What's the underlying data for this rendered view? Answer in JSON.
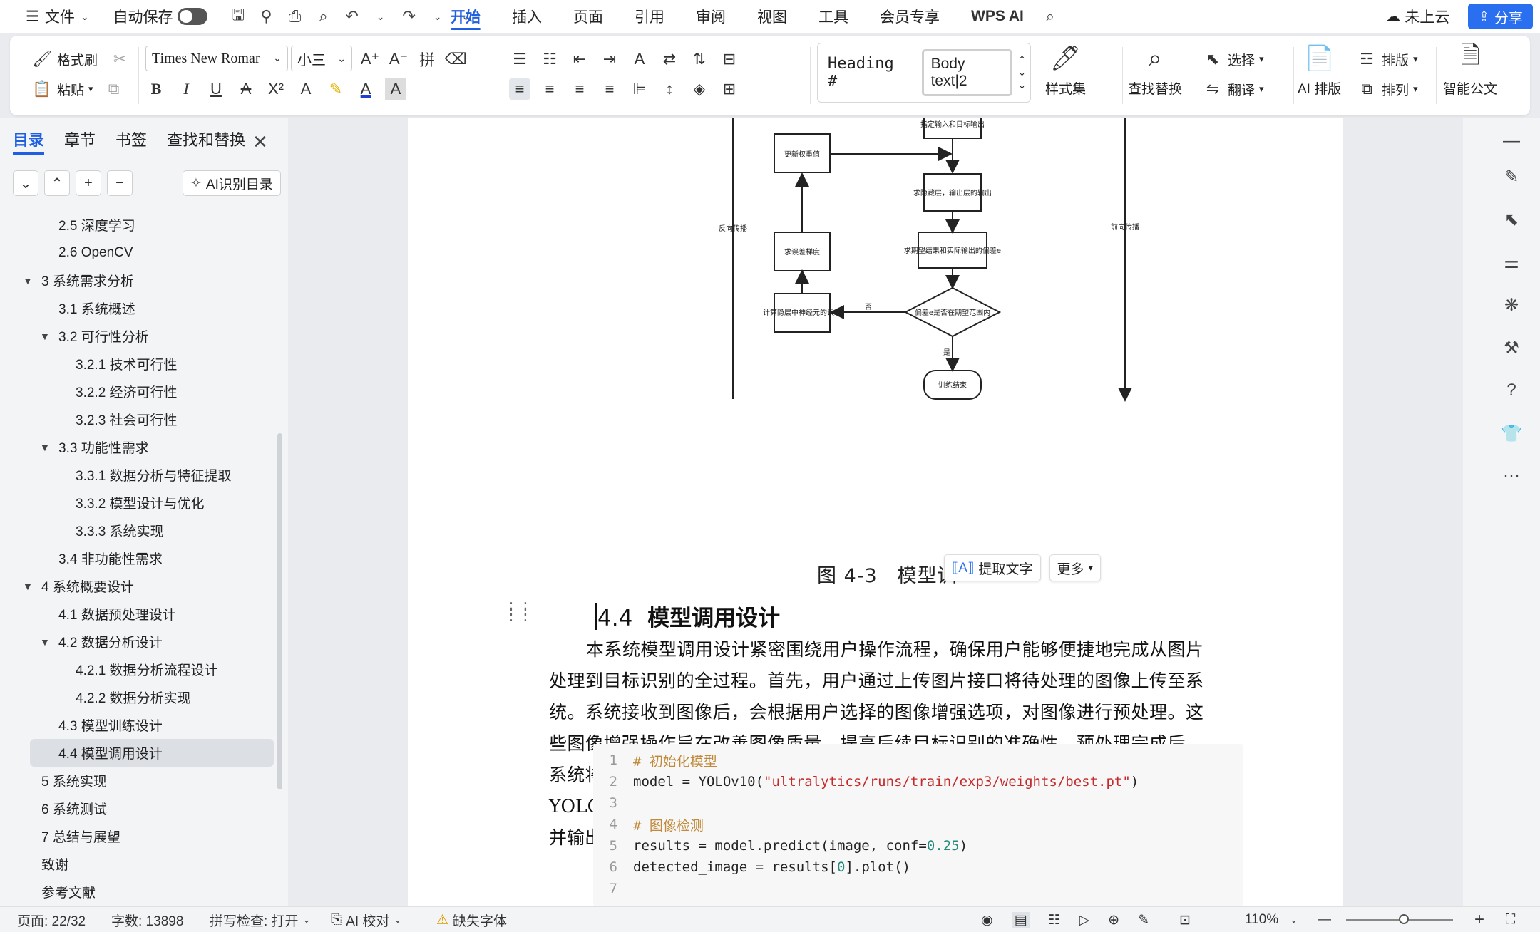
{
  "menubar": {
    "file": "文件",
    "autosave": "自动保存",
    "tabs": [
      "开始",
      "插入",
      "页面",
      "引用",
      "审阅",
      "视图",
      "工具",
      "会员专享",
      "WPS AI"
    ],
    "active_tab": "开始",
    "cloud": "未上云",
    "share": "分享"
  },
  "ribbon": {
    "format_painter": "格式刷",
    "paste": "粘贴",
    "font_name": "Times New Romar",
    "font_size": "小三",
    "style_heading": "Heading #",
    "style_body": "Body text|2",
    "style_set": "样式集",
    "find_replace": "查找替换",
    "select": "选择",
    "translate": "翻译",
    "ai_layout": "AI 排版",
    "typeset": "排版",
    "arrange": "排列",
    "smart_doc": "智能公文"
  },
  "nav": {
    "tabs": [
      "目录",
      "章节",
      "书签",
      "查找和替换"
    ],
    "active_tab": "目录",
    "ai_toc": "AI识别目录",
    "toc": [
      {
        "label": "2.5 深度学习",
        "level": 2,
        "expander": ""
      },
      {
        "label": "2.6 OpenCV",
        "level": 2,
        "expander": ""
      },
      {
        "label": "3 系统需求分析",
        "level": 1,
        "expander": "open"
      },
      {
        "label": "3.1 系统概述",
        "level": 2,
        "expander": ""
      },
      {
        "label": "3.2 可行性分析",
        "level": 2,
        "expander": "open"
      },
      {
        "label": "3.2.1 技术可行性",
        "level": 3,
        "expander": ""
      },
      {
        "label": "3.2.2 经济可行性",
        "level": 3,
        "expander": ""
      },
      {
        "label": "3.2.3 社会可行性",
        "level": 3,
        "expander": ""
      },
      {
        "label": "3.3 功能性需求",
        "level": 2,
        "expander": "open"
      },
      {
        "label": "3.3.1 数据分析与特征提取",
        "level": 3,
        "expander": ""
      },
      {
        "label": "3.3.2 模型设计与优化",
        "level": 3,
        "expander": ""
      },
      {
        "label": "3.3.3 系统实现",
        "level": 3,
        "expander": ""
      },
      {
        "label": "3.4 非功能性需求",
        "level": 2,
        "expander": ""
      },
      {
        "label": "4 系统概要设计",
        "level": 1,
        "expander": "open"
      },
      {
        "label": "4.1 数据预处理设计",
        "level": 2,
        "expander": ""
      },
      {
        "label": "4.2 数据分析设计",
        "level": 2,
        "expander": "open"
      },
      {
        "label": "4.2.1 数据分析流程设计",
        "level": 3,
        "expander": ""
      },
      {
        "label": "4.2.2 数据分析实现",
        "level": 3,
        "expander": ""
      },
      {
        "label": "4.3 模型训练设计",
        "level": 2,
        "expander": ""
      },
      {
        "label": "4.4 模型调用设计",
        "level": 2,
        "expander": "",
        "selected": true
      },
      {
        "label": "5 系统实现",
        "level": 1,
        "expander": ""
      },
      {
        "label": "6 系统测试",
        "level": 1,
        "expander": ""
      },
      {
        "label": "7 总结与展望",
        "level": 1,
        "expander": ""
      },
      {
        "label": "致谢",
        "level": 1,
        "expander": ""
      },
      {
        "label": "参考文献",
        "level": 1,
        "expander": ""
      }
    ]
  },
  "flowchart": {
    "top_box": "指定输入和目标输出",
    "update_weights": "更新权重值",
    "hidden_output": "求隐藏层，输出层的输出",
    "error_gradient": "求误差梯度",
    "deviation": "求期望结果和实际输出的偏差e",
    "hidden_error": "计算隐层中神经元的误差",
    "decision": "偏差e是否在期望范围内",
    "no": "否",
    "yes": "是",
    "end": "训练结束",
    "back_prop": "反向传播",
    "forward_prop": "前向传播"
  },
  "document": {
    "caption": "图 4-3　模型训",
    "float_extract": "提取文字",
    "float_more": "更多",
    "heading_num": "4.4",
    "heading_text": "模型调用设计",
    "paragraph": "本系统模型调用设计紧密围绕用户操作流程，确保用户能够便捷地完成从图片处理到目标识别的全过程。首先，用户通过上传图片接口将待处理的图像上传至系统。系统接收到图像后，会根据用户选择的图像增强选项，对图像进行预处理。这些图像增强操作旨在改善图像质量，提高后续目标识别的准确性。预处理完成后，系统将增强后的图像输入到基于 YOLOv10 算法的深度学习模型中进行目标检测。YOLOv10 模型在 PyTorch 框架下运行，能够快速、准确地识别图像中的目标，并输出检测结果的坐标和置信度信息。",
    "code": {
      "line_numbers": [
        "1",
        "2",
        "3",
        "4",
        "5",
        "6",
        "7"
      ],
      "l1_comment": "# 初始化模型",
      "l2_a": "model = YOLOv10(",
      "l2_str": "\"ultralytics/runs/train/exp3/weights/best.pt\"",
      "l2_b": ")",
      "l4_comment": "# 图像检测",
      "l5_a": "results = model.predict(image, conf=",
      "l5_num": "0.25",
      "l5_b": ")",
      "l6_a": "detected_image = results[",
      "l6_num": "0",
      "l6_b": "].plot()"
    }
  },
  "statusbar": {
    "page": "页面: 22/32",
    "words": "字数: 13898",
    "spell": "拼写检查: 打开",
    "ai_check": "AI 校对",
    "missing_font": "缺失字体",
    "zoom": "110%"
  }
}
